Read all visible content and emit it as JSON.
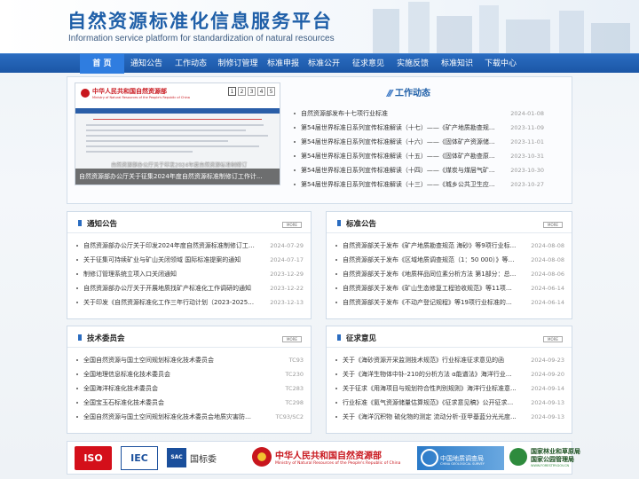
{
  "site": {
    "title": "自然资源标准化信息服务平台",
    "subtitle": "Information service platform for standardization of natural resources"
  },
  "nav": [
    "首 页",
    "通知公告",
    "工作动态",
    "制修订管理",
    "标准申报",
    "标准公开",
    "征求意见",
    "实施反馈",
    "标准知识",
    "下载中心"
  ],
  "banner": {
    "ministry_cn": "中华人民共和国自然资源部",
    "ministry_en": "Ministry of Natural Resources of the People's Republic of China",
    "caption": "自然资源部办公厅关于征集2024年度自然资源标准制修订工作计...",
    "caption_ghost": "自然资源部办公厅关于印发2024年度自然资源标准制修订",
    "pages": [
      "1",
      "2",
      "3",
      "4",
      "5"
    ],
    "active_page": 1
  },
  "news": {
    "title": "工作动态",
    "items": [
      {
        "t": "自然资源部发布十七项行业标准",
        "d": "2024-01-08"
      },
      {
        "t": "第54届世界标准日系列宣传标准解读（十七）——《矿产地质勘查规...",
        "d": "2023-11-09"
      },
      {
        "t": "第54届世界标准日系列宣传标准解读（十六）——《固体矿产资源储...",
        "d": "2023-11-01"
      },
      {
        "t": "第54届世界标准日系列宣传标准解读（十五）——《固体矿产勘查原...",
        "d": "2023-10-31"
      },
      {
        "t": "第54届世界标准日系列宣传标准解读（十四）——《煤炭与煤层气矿...",
        "d": "2023-10-30"
      },
      {
        "t": "第54届世界标准日系列宣传标准解读（十三）——《城乡公共卫生应...",
        "d": "2023-10-27"
      }
    ]
  },
  "notice": {
    "title": "通知公告",
    "more": "MORE",
    "items": [
      {
        "t": "自然资源部办公厅关于印发2024年度自然资源标准制修订工作...",
        "d": "2024-07-29"
      },
      {
        "t": "关于征集可持续矿业与矿山关闭领域 国际标准提案的通知",
        "d": "2024-07-17"
      },
      {
        "t": "制修订管理系统立项入口关闭通知",
        "d": "2023-12-29"
      },
      {
        "t": "自然资源部办公厅关于开展地质找矿产标准化工作调研的通知",
        "d": "2023-12-22"
      },
      {
        "t": "关于印发《自然资源标准化工作三年行动计划（2023-2025年...",
        "d": "2023-12-13"
      }
    ]
  },
  "publish": {
    "title": "标准公告",
    "more": "MORE",
    "items": [
      {
        "t": "自然资源部关于发布《矿产地质勘查规范 海砂》等9项行业标...",
        "d": "2024-08-08"
      },
      {
        "t": "自然资源部关于发布《区域地质调查规范（1：50 000）》等2...",
        "d": "2024-08-08"
      },
      {
        "t": "自然资源部关于发布《地质样品同位素分析方法 第1部分：总...",
        "d": "2024-08-06"
      },
      {
        "t": "自然资源部关于发布《矿山生态修复工程验收规范》等11项行...",
        "d": "2024-06-14"
      },
      {
        "t": "自然资源部关于发布《不动产登记规程》等19项行业标准的公告",
        "d": "2024-06-14"
      }
    ]
  },
  "committee": {
    "title": "技术委员会",
    "more": "MORE",
    "items": [
      {
        "t": "全国自然资源与国土空间规划标准化技术委员会",
        "d": "TC93"
      },
      {
        "t": "全国地理信息标准化技术委员会",
        "d": "TC230"
      },
      {
        "t": "全国海洋标准化技术委员会",
        "d": "TC283"
      },
      {
        "t": "全国宝玉石标准化技术委员会",
        "d": "TC298"
      },
      {
        "t": "全国自然资源与国土空间规划标准化技术委员会地质灾害防治...",
        "d": "TC93/SC2"
      }
    ]
  },
  "opinion": {
    "title": "征求意见",
    "more": "MORE",
    "items": [
      {
        "t": "关于《海砂资源开采监测技术规范》行业标准征求意见的函",
        "d": "2024-09-23"
      },
      {
        "t": "关于《海洋生物体中钋-210的分析方法 α能谱法》海洋行业标...",
        "d": "2024-09-20"
      },
      {
        "t": "关于征求《用海项目与规划符合性判别规则》海洋行业标准意...",
        "d": "2024-09-14"
      },
      {
        "t": "行业标准《氦气资源储量估算规范》《征求意见稿》公开征求...",
        "d": "2024-09-13"
      },
      {
        "t": "关于《海洋沉积物 硫化物的测定 流动分析-亚甲基蓝分光光度...",
        "d": "2024-09-13"
      }
    ]
  },
  "logos": {
    "iso": "ISO",
    "iec": "IEC",
    "sac_badge": "SAC",
    "sac_text": "国标委",
    "mnr_cn": "中华人民共和国自然资源部",
    "mnr_en": "Ministry of Natural Resources of the People's Republic of China",
    "geo_cn": "中国地质调查局",
    "geo_en": "CHINA GEOLOGICAL SURVEY",
    "forest_cn1": "国家林业和草原局",
    "forest_cn2": "国家公园管理局",
    "forest_url": "WWW.FORESTRY.GOV.CN"
  },
  "colors": {
    "brand": "#1f5fa8",
    "nav": "#1b56a6",
    "nav_active": "#2f7de0"
  }
}
